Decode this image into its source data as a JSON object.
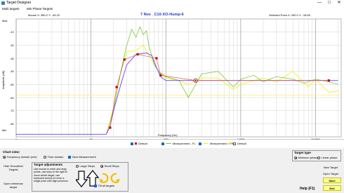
{
  "window": {
    "title": "Target Designer",
    "minimize": "—",
    "maximize": "☐",
    "close": "✕"
  },
  "menu": {
    "items": [
      "Multi targets",
      "Min Phase Targets"
    ]
  },
  "plot": {
    "max_label": "Max",
    "min_label": "Min",
    "mouse_readout": "Mouse  X: 380.2   Y: -45.22",
    "selected_readout": "Selected Point   X: 250.0   Y: -18.55",
    "title": "7 Nov _C10-XO-Hump-6",
    "ylabel": "Amplitude (dB)",
    "xlabel": "Frequency (Hz)",
    "y_ticks": [
      "-10",
      "-20",
      "-30",
      "-40",
      "-50",
      "-60",
      "-70",
      "-80"
    ],
    "x_ticks": [
      "1",
      "10",
      "100",
      "1,000",
      "10,000"
    ],
    "colors": {
      "target": "#c00000",
      "default_line": "#6a3cff",
      "measurement_fl": "#7cc83c",
      "measurement_fr": "#f0f000",
      "default_dash": "#ffd700",
      "title": "#1e3cc8"
    }
  },
  "chart_data": {
    "type": "line",
    "x_scale": "log",
    "xlim": [
      1,
      22000
    ],
    "ylim": [
      -90,
      0
    ],
    "x_ticks": [
      1,
      10,
      100,
      1000,
      10000
    ],
    "y_ticks": [
      -10,
      -20,
      -30,
      -40,
      -50,
      -60,
      -70,
      -80
    ],
    "title": "7 Nov _C10-XO-Hump-6",
    "xlabel": "Frequency (Hz)",
    "ylabel": "Amplitude (dB)",
    "series": [
      {
        "name": "Default",
        "x": [
          1,
          10,
          16,
          18,
          20,
          25,
          30,
          40,
          55,
          65,
          75,
          85,
          100,
          150,
          250,
          500,
          1000,
          2000,
          5000,
          10000,
          15000,
          20000
        ],
        "y": [
          -88,
          -88,
          -88,
          -82,
          -70,
          -50,
          -35,
          -27,
          -26,
          -28,
          -37,
          -44,
          -47,
          -47,
          -47,
          -47,
          -47,
          -47,
          -47,
          -47,
          -47,
          -47
        ]
      },
      {
        "name": "Measurement - FL",
        "x": [
          16,
          20,
          25,
          30,
          35,
          40,
          45,
          50,
          55,
          60,
          65,
          70,
          80,
          100,
          150,
          200,
          300,
          500,
          800,
          1000,
          1500,
          2000,
          3000,
          5000,
          7000,
          10000,
          15000,
          20000
        ],
        "y": [
          -88,
          -70,
          -40,
          -20,
          -8,
          -14,
          -6,
          -12,
          -9,
          -22,
          -28,
          -35,
          -40,
          -44,
          -47,
          -60,
          -42,
          -40,
          -52,
          -46,
          -43,
          -48,
          -44,
          -46,
          -49,
          -46,
          -48,
          -50
        ]
      },
      {
        "name": "Measurement - FR",
        "x": [
          16,
          20,
          25,
          30,
          40,
          50,
          60,
          80,
          100,
          150,
          200,
          300,
          500,
          800,
          1000,
          2000,
          3000,
          5000,
          8000,
          10000,
          15000,
          20000
        ],
        "y": [
          -88,
          -68,
          -40,
          -25,
          -24,
          -20,
          -28,
          -40,
          -45,
          -47,
          -50,
          -45,
          -45,
          -54,
          -50,
          -45,
          -48,
          -40,
          -52,
          -46,
          -56,
          -55
        ]
      }
    ],
    "target_points": [
      {
        "x": 18,
        "y": -83
      },
      {
        "x": 22,
        "y": -52
      },
      {
        "x": 28,
        "y": -31
      },
      {
        "x": 42,
        "y": -27
      },
      {
        "x": 75,
        "y": -30
      },
      {
        "x": 85,
        "y": -43
      },
      {
        "x": 250,
        "y": -47,
        "selected": true
      },
      {
        "x": 15000,
        "y": -47
      }
    ],
    "reference_level": -58,
    "grid": true
  },
  "legend": {
    "default_label": "Default",
    "measurement_fl_label": "Measurement - FL",
    "measurement_fr_label": "Measurement - FR",
    "default2_label": "Default"
  },
  "chart_view": {
    "title": "Chart view:",
    "options": [
      "Frequency domain (mH)",
      "Time domain",
      "View Measurement"
    ]
  },
  "side_buttons": {
    "hide_smoothed": "Hide Smoothed Targets",
    "open_reference": "Open reference target"
  },
  "adjustments": {
    "title": "Target adjustments",
    "description": "Use mouse to enter and drag points, use keys to the right to move whole target, use keyboard arrows to move a single point with high precision",
    "large_steps": "Large Steps",
    "small_steps": "Small Steps",
    "tilt_all": "Tilt all targets"
  },
  "target_type": {
    "title": "Target type",
    "minimum_phase": "Minimum phase",
    "linear_phase": "Linear phase"
  },
  "actions": {
    "new_target": "New Target",
    "open_target": "Open Target",
    "save": "Save",
    "exit": "Exit",
    "help": "Help (F1)"
  }
}
